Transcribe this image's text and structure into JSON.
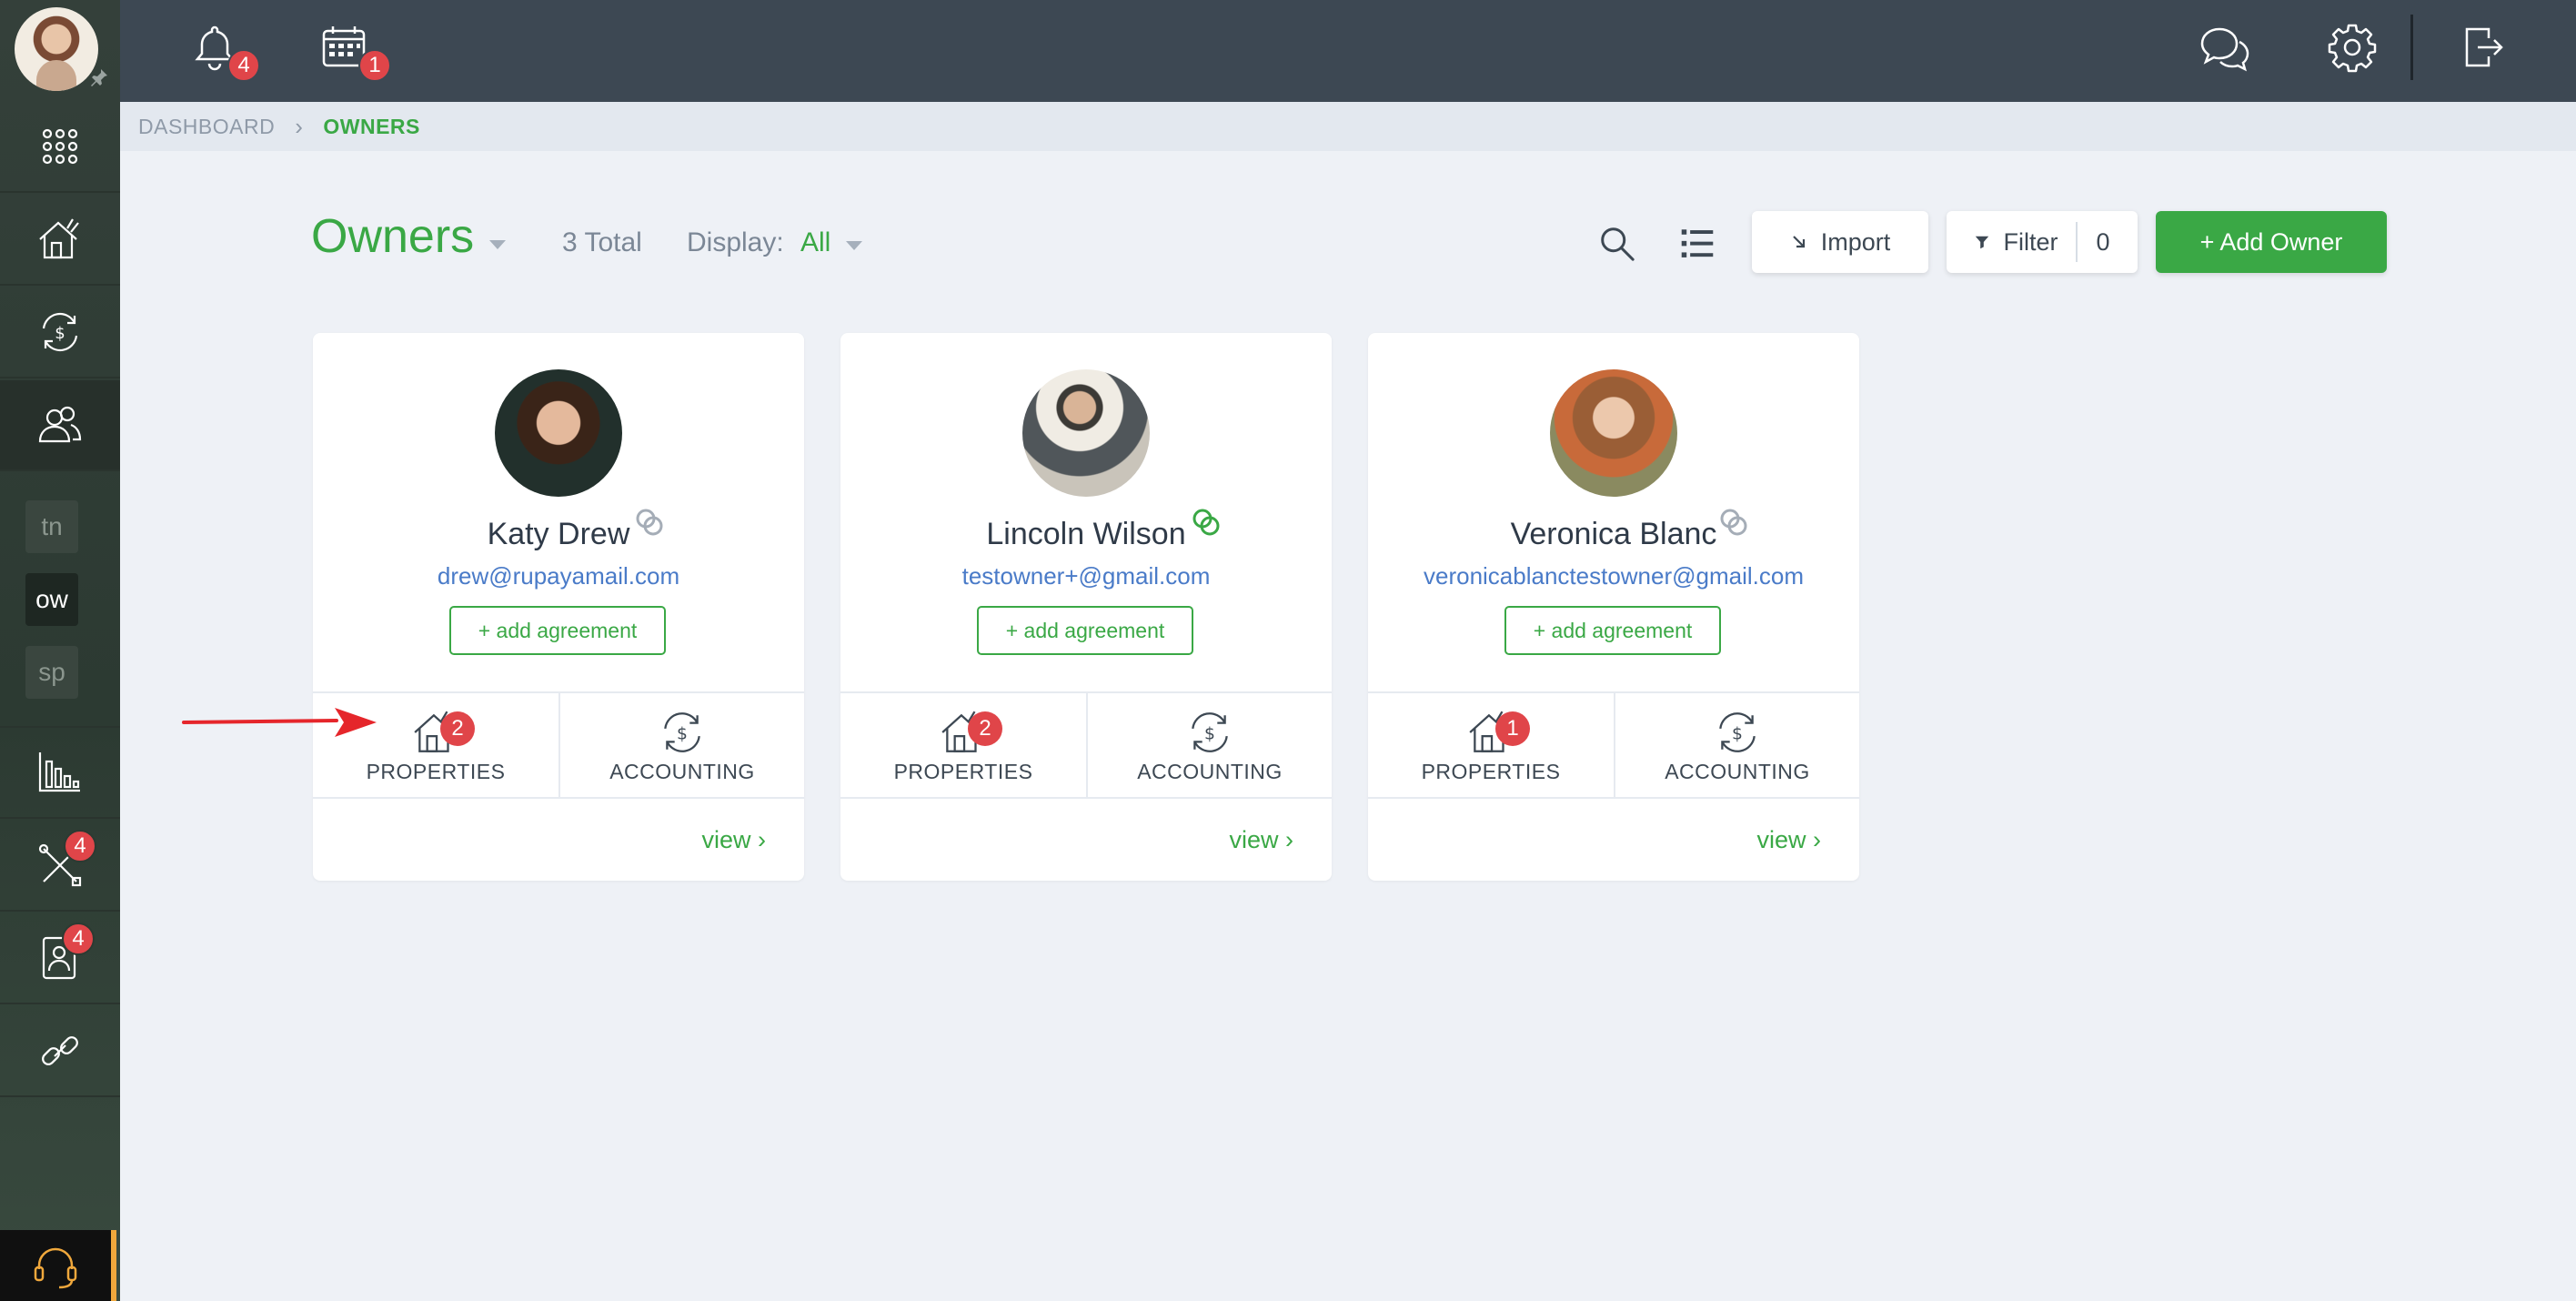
{
  "topbar": {
    "notifications_count": "4",
    "calendar_count": "1",
    "icons": [
      "bell-icon",
      "calendar-icon",
      "chat-icon",
      "gear-icon",
      "logout-icon"
    ]
  },
  "sidebar": {
    "squares": [
      "tn",
      "ow",
      "sp"
    ],
    "maintenance_count": "4",
    "tenants_count": "4",
    "icons": [
      "apps-grid-icon",
      "properties-icon",
      "accounting-icon",
      "owners-icon",
      "reports-icon",
      "maintenance-icon",
      "tenants-icon",
      "link-icon",
      "headset-icon"
    ]
  },
  "breadcrumb": {
    "root": "DASHBOARD",
    "current": "OWNERS"
  },
  "header": {
    "title": "Owners",
    "total": "3 Total",
    "display_label": "Display:",
    "display_value": "All",
    "import_label": "Import",
    "filter_label": "Filter",
    "filter_count": "0",
    "add_label": "+ Add Owner"
  },
  "owners": [
    {
      "name": "Katy Drew",
      "email": "drew@rupayamail.com",
      "agreement_label": "+ add agreement",
      "properties_label": "PROPERTIES",
      "properties_count": "2",
      "accounting_label": "ACCOUNTING",
      "view_label": "view",
      "linked": false
    },
    {
      "name": "Lincoln Wilson",
      "email": "testowner+@gmail.com",
      "agreement_label": "+ add agreement",
      "properties_label": "PROPERTIES",
      "properties_count": "2",
      "accounting_label": "ACCOUNTING",
      "view_label": "view",
      "linked": true
    },
    {
      "name": "Veronica Blanc",
      "email": "veronicablanctestowner@gmail.com",
      "agreement_label": "+ add agreement",
      "properties_label": "PROPERTIES",
      "properties_count": "1",
      "accounting_label": "ACCOUNTING",
      "view_label": "view",
      "linked": false
    }
  ],
  "colors": {
    "accent": "#3aa845",
    "topbar": "#3d4853",
    "badge": "#e04549",
    "link": "#4a7bc8",
    "annotation_arrow": "#e5262b"
  }
}
